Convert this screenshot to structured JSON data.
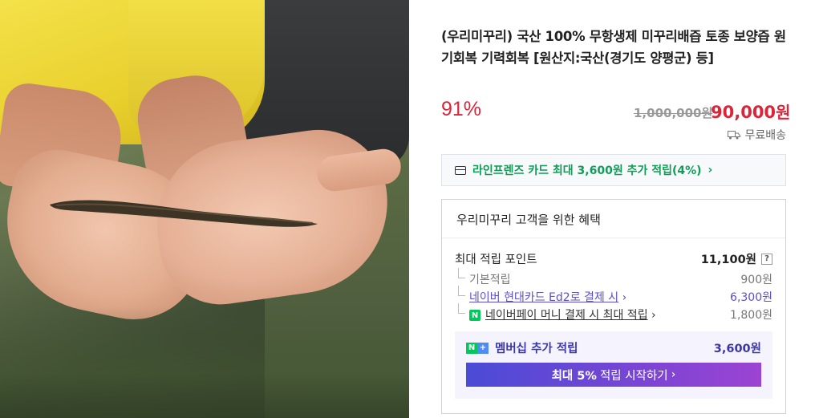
{
  "product": {
    "title": "(우리미꾸리) 국산 100% 무항생제 미꾸리배즙 토종 보양즙 원기회복 기력회복 [원산지:국산(경기도 양평군) 등]",
    "discount_rate": "91%",
    "original_price": "1,000,000원",
    "sale_price_value": "90,000",
    "sale_price_unit": "원",
    "shipping": "무료배송"
  },
  "card_promo": {
    "text": "라인프렌즈 카드 최대 3,600원 추가 적립(4%)",
    "chevron": "›"
  },
  "benefit": {
    "heading": "우리미꾸리 고객을 위한 혜택",
    "max_points_label": "최대 적립 포인트",
    "max_points_value": "11,100원",
    "help": "?",
    "rows": [
      {
        "label": "기본적립",
        "value": "900원"
      },
      {
        "label": "네이버 현대카드 Ed2로 결제 시",
        "chevron": "›",
        "value": "6,300원"
      },
      {
        "badge": "N",
        "label": "네이버페이 머니 결제 시 최대 적립",
        "chevron": "›",
        "value": "1,800원"
      }
    ],
    "membership": {
      "badge_n": "N",
      "badge_plus": "+",
      "label": "멤버십 추가 적립",
      "value": "3,600원",
      "cta_prefix": "최대 5%",
      "cta_suffix": "적립 시작하기",
      "cta_chevron": "›"
    }
  },
  "colors": {
    "accent_red": "#d9263a",
    "green": "#0f9d58",
    "purple": "#5b4fd1"
  }
}
